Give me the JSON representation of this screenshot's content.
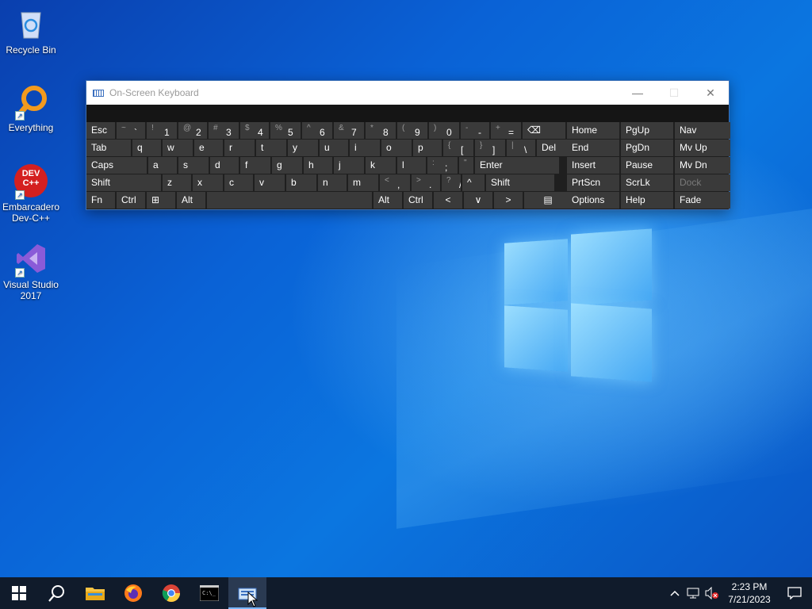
{
  "desktop": {
    "icons": [
      {
        "label": "Recycle Bin",
        "icon": "recycle-bin-icon"
      },
      {
        "label": "Everything",
        "icon": "everything-search-icon"
      },
      {
        "label": "Embarcadero Dev-C++",
        "icon": "devcpp-icon",
        "badge": "DEV C++"
      },
      {
        "label": "Visual Studio 2017",
        "icon": "visual-studio-icon"
      }
    ]
  },
  "osk": {
    "title": "On-Screen Keyboard",
    "controls": {
      "minimize": "—",
      "maximize": "☐",
      "close": "✕"
    },
    "row1": [
      {
        "pri": "Esc"
      },
      {
        "sec": "~",
        "pri": "`"
      },
      {
        "sec": "!",
        "pri": "1"
      },
      {
        "sec": "@",
        "pri": "2"
      },
      {
        "sec": "#",
        "pri": "3"
      },
      {
        "sec": "$",
        "pri": "4"
      },
      {
        "sec": "%",
        "pri": "5"
      },
      {
        "sec": "^",
        "pri": "6"
      },
      {
        "sec": "&",
        "pri": "7"
      },
      {
        "sec": "*",
        "pri": "8"
      },
      {
        "sec": "(",
        "pri": "9"
      },
      {
        "sec": ")",
        "pri": "0"
      },
      {
        "sec": "-",
        "pri": "-"
      },
      {
        "sec": "+",
        "pri": "="
      },
      {
        "pri": "⌫"
      }
    ],
    "row2": [
      "Tab",
      "q",
      "w",
      "e",
      "r",
      "t",
      "y",
      "u",
      "i",
      "o",
      "p",
      "[",
      "]",
      "\\",
      "Del"
    ],
    "row2_sec": {
      "11": "{",
      "12": "}",
      "13": "|"
    },
    "row3": [
      "Caps",
      "a",
      "s",
      "d",
      "f",
      "g",
      "h",
      "j",
      "k",
      "l",
      ";",
      "'",
      "Enter"
    ],
    "row3_sec": {
      "10": ":",
      "11": "\""
    },
    "row4": [
      "Shift",
      "z",
      "x",
      "c",
      "v",
      "b",
      "n",
      "m",
      ",",
      ".",
      "/",
      "^",
      "Shift"
    ],
    "row4_sec": {
      "8": "<",
      "9": ">",
      "10": "?"
    },
    "row5": [
      "Fn",
      "Ctrl",
      "⊞",
      "Alt",
      "",
      "Alt",
      "Ctrl",
      "<",
      "∨",
      ">",
      "▤"
    ],
    "nav_keys": [
      [
        "Home",
        "PgUp",
        "Nav"
      ],
      [
        "End",
        "PgDn",
        "Mv Up"
      ],
      [
        "Insert",
        "Pause",
        "Mv Dn"
      ],
      [
        "PrtScn",
        "ScrLk",
        "Dock"
      ],
      [
        "Options",
        "Help",
        "Fade"
      ]
    ]
  },
  "taskbar": {
    "items": [
      {
        "name": "start-button",
        "icon": "windows-logo-icon"
      },
      {
        "name": "search-button",
        "icon": "search-icon"
      },
      {
        "name": "file-explorer-button",
        "icon": "folder-icon"
      },
      {
        "name": "firefox-button",
        "icon": "firefox-icon"
      },
      {
        "name": "chrome-button",
        "icon": "chrome-icon"
      },
      {
        "name": "command-prompt-button",
        "icon": "terminal-icon"
      },
      {
        "name": "on-screen-keyboard-button",
        "icon": "keyboard-icon",
        "active": true
      }
    ],
    "clock": {
      "time": "2:23 PM",
      "date": "7/21/2023"
    },
    "tray_icons": [
      "chevron-up-icon",
      "network-icon",
      "volume-muted-icon",
      "notification-icon"
    ]
  }
}
